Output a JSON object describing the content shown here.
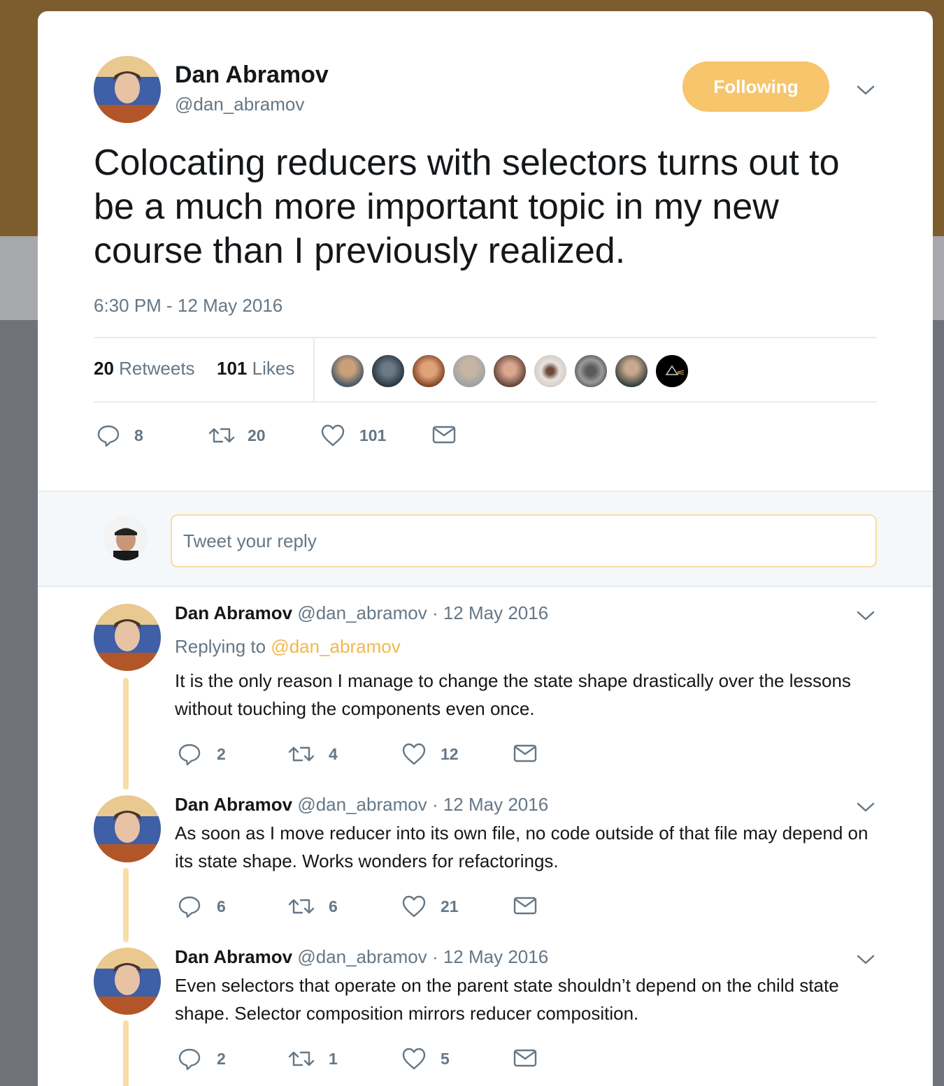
{
  "tweet": {
    "author_name": "Dan Abramov",
    "author_handle": "@dan_abramov",
    "follow_label": "Following",
    "text": "Colocating reducers with selectors turns out to be a much more important topic in my new course than I previously realized.",
    "timestamp": "6:30 PM - 12 May 2016",
    "retweets_count": "20",
    "retweets_label": "Retweets",
    "likes_count": "101",
    "likes_label": "Likes",
    "actions": {
      "replies": "8",
      "retweets": "20",
      "likes": "101"
    }
  },
  "reply_box": {
    "placeholder": "Tweet your reply"
  },
  "replies": [
    {
      "author_name": "Dan Abramov",
      "author_handle": "@dan_abramov",
      "separator": "·",
      "date": "12 May 2016",
      "replying_prefix": "Replying to",
      "replying_to": "@dan_abramov",
      "text": "It is the only reason I manage to change the state shape drastically over the lessons without touching the components even once.",
      "replies": "2",
      "retweets": "4",
      "likes": "12"
    },
    {
      "author_name": "Dan Abramov",
      "author_handle": "@dan_abramov",
      "separator": "·",
      "date": "12 May 2016",
      "text": "As soon as I move reducer into its own file, no code outside of that file may depend on its state shape. Works wonders for refactorings.",
      "replies": "6",
      "retweets": "6",
      "likes": "21"
    },
    {
      "author_name": "Dan Abramov",
      "author_handle": "@dan_abramov",
      "separator": "·",
      "date": "12 May 2016",
      "text": "Even selectors that operate on the parent state shouldn’t depend on the child state shape. Selector composition mirrors reducer composition.",
      "replies": "2",
      "retweets": "1",
      "likes": "5"
    }
  ],
  "colors": {
    "accent": "#f6c56c",
    "link": "#f5b74a",
    "muted": "#657786",
    "thread_line": "#f9dda7"
  }
}
